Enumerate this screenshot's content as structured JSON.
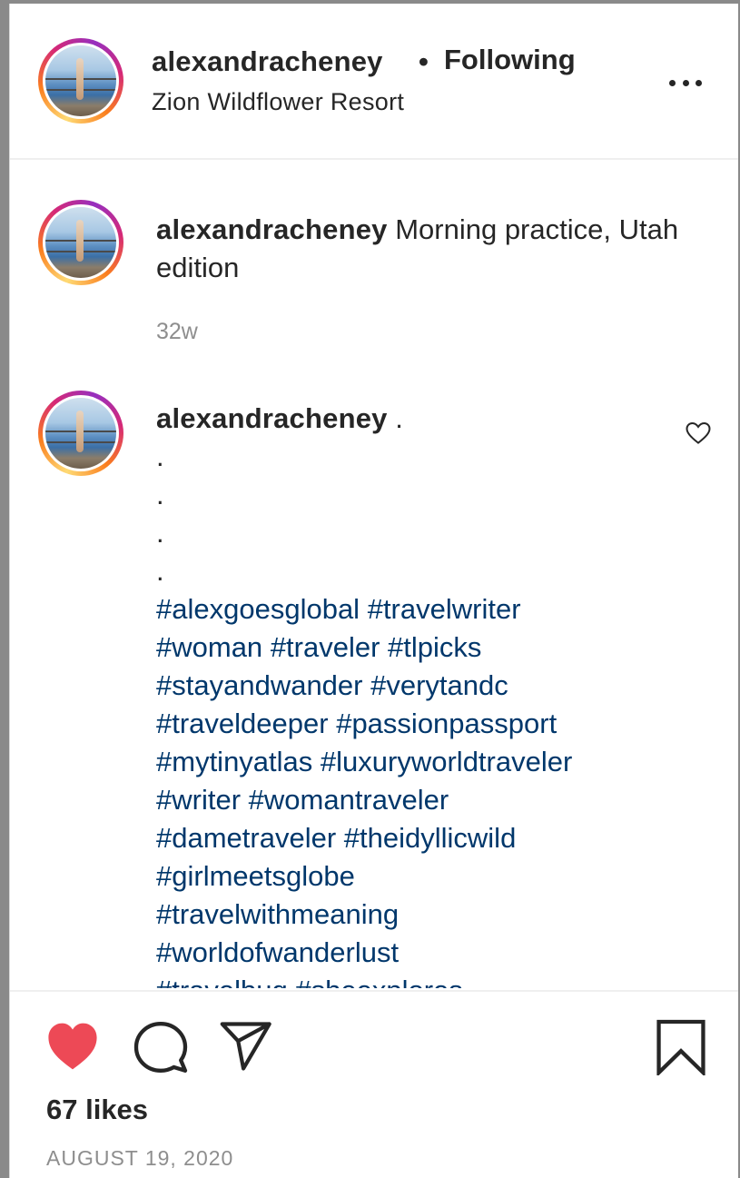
{
  "header": {
    "username": "alexandracheney",
    "separator": "•",
    "follow_label": "Following",
    "location": "Zion Wildflower Resort",
    "more_icon": "more-dots-icon"
  },
  "comments": [
    {
      "username": "alexandracheney",
      "text": " Morning practice, Utah edition",
      "time": "32w"
    },
    {
      "username": "alexandracheney",
      "text_first": " .",
      "dot_lines": [
        ".",
        ".",
        ".",
        "."
      ],
      "hashtags": [
        "#alexgoesglobal",
        "#travelwriter",
        "#woman",
        "#traveler",
        "#tlpicks",
        "#stayandwander",
        "#verytandc",
        "#traveldeeper",
        "#passionpassport",
        "#mytinyatlas",
        "#luxuryworldtraveler",
        "#writer",
        "#womantraveler",
        "#dametraveler",
        "#theidyllicwild",
        "#girlmeetsglobe",
        "#travelwithmeaning",
        "#worldofwanderlust",
        "#travelbug",
        "#sheexplores"
      ],
      "like_icon": "heart-outline-icon"
    }
  ],
  "actions": {
    "like_icon": "heart-filled-icon",
    "comment_icon": "comment-bubble-icon",
    "share_icon": "paper-plane-icon",
    "save_icon": "bookmark-icon",
    "likes_text": "67 likes",
    "date": "AUGUST 19, 2020"
  },
  "colors": {
    "text": "#262626",
    "muted": "#8e8e8e",
    "hashtag": "#00376b",
    "like_red": "#ed4956"
  }
}
